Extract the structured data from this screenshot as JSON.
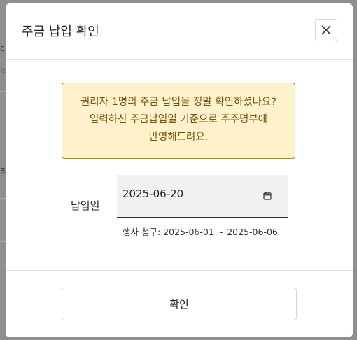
{
  "dialog": {
    "title": "주금 납입 확인",
    "alert_lines": [
      "권리자 1명의 주금 납입을 정말 확인하셨나요?",
      "입력하신 주금납입일 기준으로 주주명부에",
      "반영해드려요."
    ],
    "payment_date": {
      "label": "납입일",
      "value": "2025-06-20",
      "helper": "행사 청구: 2025-06-01 ~ 2025-06-06"
    },
    "confirm_label": "확인"
  },
  "colors": {
    "overlay": "#8f8f8f",
    "alert_bg": "#fdf2cc",
    "alert_border": "#b58a12",
    "alert_text": "#7a5208",
    "date_field_bg": "#f1f1f1"
  },
  "icons": [
    "close-icon",
    "calendar-icon"
  ]
}
